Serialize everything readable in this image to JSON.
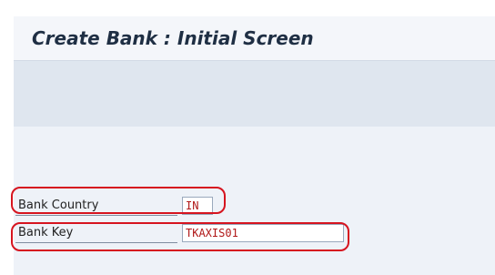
{
  "screen": {
    "title": "Create Bank : Initial Screen"
  },
  "form": {
    "bank_country": {
      "label": "Bank Country",
      "value": "IN"
    },
    "bank_key": {
      "label": "Bank Key",
      "value": "TKAXIS01"
    }
  },
  "colors": {
    "highlight": "#d6141f",
    "input_text": "#b01818"
  }
}
